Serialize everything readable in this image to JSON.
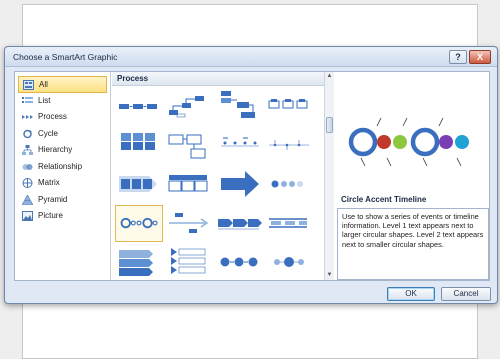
{
  "dialog": {
    "title": "Choose a SmartArt Graphic",
    "help_label": "?",
    "close_label": "X"
  },
  "categories": [
    {
      "label": "All",
      "icon": "all-icon",
      "selected": true
    },
    {
      "label": "List",
      "icon": "list-icon"
    },
    {
      "label": "Process",
      "icon": "process-icon"
    },
    {
      "label": "Cycle",
      "icon": "cycle-icon"
    },
    {
      "label": "Hierarchy",
      "icon": "hierarchy-icon"
    },
    {
      "label": "Relationship",
      "icon": "relationship-icon"
    },
    {
      "label": "Matrix",
      "icon": "matrix-icon"
    },
    {
      "label": "Pyramid",
      "icon": "pyramid-icon"
    },
    {
      "label": "Picture",
      "icon": "picture-icon"
    }
  ],
  "gallery": {
    "heading": "Process",
    "selected_item": "Circle Accent Timeline"
  },
  "details": {
    "name": "Circle Accent Timeline",
    "description": "Use to show a series of events or timeline information. Level 1 text appears next to larger circular shapes. Level 2 text appears next to smaller circular shapes."
  },
  "buttons": {
    "ok": "OK",
    "cancel": "Cancel"
  },
  "colors": {
    "accent_blue": "#3a6fbf",
    "selection_gold": "#ffe183",
    "preview_red": "#c0392b",
    "preview_green": "#8dc63f",
    "preview_purple": "#7b3fb5",
    "preview_cyan": "#1fa2d6"
  }
}
